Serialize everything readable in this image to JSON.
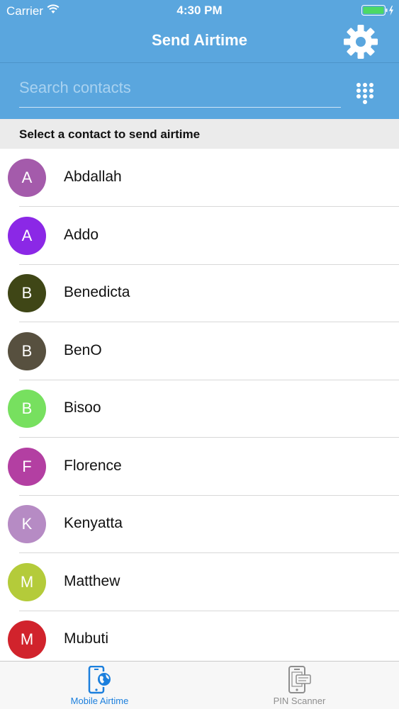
{
  "status_bar": {
    "carrier": "Carrier",
    "time": "4:30 PM",
    "icons": [
      "wifi-icon",
      "battery-icon"
    ]
  },
  "nav": {
    "title": "Send Airtime",
    "settings_icon": "gear-icon"
  },
  "search": {
    "placeholder": "Search contacts",
    "value": "",
    "dialpad_icon": "dialpad-icon"
  },
  "section_label": "Select a contact to send airtime",
  "contacts": [
    {
      "initial": "A",
      "name": "Abdallah",
      "color": "#a45bab"
    },
    {
      "initial": "A",
      "name": "Addo",
      "color": "#8b28e6"
    },
    {
      "initial": "B",
      "name": "Benedicta",
      "color": "#3f4616"
    },
    {
      "initial": "B",
      "name": "BenO",
      "color": "#57503f"
    },
    {
      "initial": "B",
      "name": "Bisoo",
      "color": "#77e05f"
    },
    {
      "initial": "F",
      "name": "Florence",
      "color": "#b33fa2"
    },
    {
      "initial": "K",
      "name": "Kenyatta",
      "color": "#b68bc4"
    },
    {
      "initial": "M",
      "name": "Matthew",
      "color": "#b4cb3a"
    },
    {
      "initial": "M",
      "name": "Mubuti",
      "color": "#d1232c"
    }
  ],
  "tabs": [
    {
      "label": "Mobile Airtime",
      "icon": "mobile-airtime-icon",
      "active": true
    },
    {
      "label": "PIN Scanner",
      "icon": "pin-scanner-icon",
      "active": false
    }
  ],
  "colors": {
    "header": "#5aa6de",
    "active_tab": "#1b7fdd",
    "inactive_tab": "#8e8e8e"
  }
}
